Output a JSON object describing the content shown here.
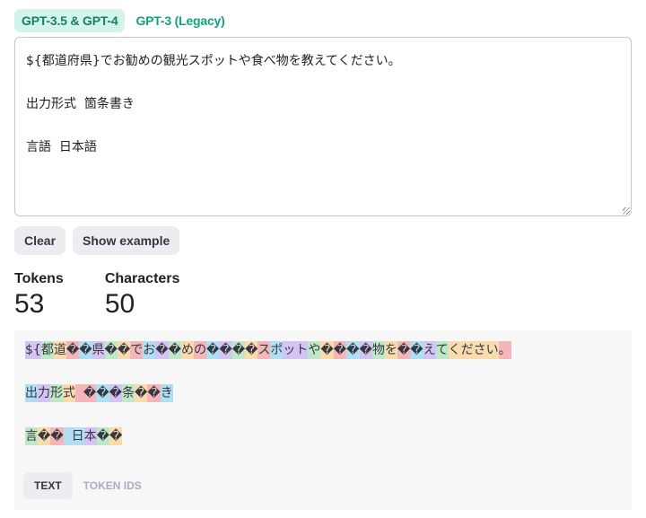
{
  "model_tabs": [
    {
      "label": "GPT-3.5 & GPT-4",
      "active": true
    },
    {
      "label": "GPT-3 (Legacy)",
      "active": false
    }
  ],
  "prompt": {
    "value": "${都道府県}でお勧めの観光スポットや食べ物を教えてください。\n\n出力形式  箇条書き\n\n言語  日本語"
  },
  "buttons": {
    "clear": "Clear",
    "show_example": "Show example"
  },
  "stats": {
    "tokens_label": "Tokens",
    "tokens_value": "53",
    "characters_label": "Characters",
    "characters_value": "50"
  },
  "token_palette": [
    "#d4c4f4",
    "#bfe8c8",
    "#f9dbae",
    "#f5b6ba",
    "#b0dff4"
  ],
  "tokenized_lines": [
    [
      {
        "t": "${",
        "c": 0
      },
      {
        "t": "都",
        "c": 1
      },
      {
        "t": "道",
        "c": 2
      },
      {
        "t": "�",
        "c": 3
      },
      {
        "t": "�",
        "c": 4
      },
      {
        "t": "県",
        "c": 0
      },
      {
        "t": "�",
        "c": 1
      },
      {
        "t": "�",
        "c": 2
      },
      {
        "t": "で",
        "c": 3
      },
      {
        "t": "お",
        "c": 4
      },
      {
        "t": "�",
        "c": 0
      },
      {
        "t": "�",
        "c": 1
      },
      {
        "t": "め",
        "c": 2
      },
      {
        "t": "の",
        "c": 3
      },
      {
        "t": "�",
        "c": 4
      },
      {
        "t": "�",
        "c": 0
      },
      {
        "t": "�",
        "c": 1
      },
      {
        "t": "�",
        "c": 2
      },
      {
        "t": "ス",
        "c": 3
      },
      {
        "t": "ポ",
        "c": 4
      },
      {
        "t": "ット",
        "c": 0
      },
      {
        "t": "や",
        "c": 1
      },
      {
        "t": "�",
        "c": 2
      },
      {
        "t": "�",
        "c": 3
      },
      {
        "t": "�",
        "c": 4
      },
      {
        "t": "�",
        "c": 0
      },
      {
        "t": "物",
        "c": 1
      },
      {
        "t": "を",
        "c": 2
      },
      {
        "t": "�",
        "c": 3
      },
      {
        "t": "�",
        "c": 4
      },
      {
        "t": "え",
        "c": 0
      },
      {
        "t": "て",
        "c": 1
      },
      {
        "t": "ください",
        "c": 2
      },
      {
        "t": "。",
        "c": 3
      }
    ],
    [
      {
        "t": "出",
        "c": 4
      },
      {
        "t": "力",
        "c": 0
      },
      {
        "t": "形",
        "c": 1
      },
      {
        "t": "式",
        "c": 2
      },
      {
        "t": "  �",
        "c": 3
      },
      {
        "t": "�",
        "c": 4
      },
      {
        "t": "�",
        "c": 0
      },
      {
        "t": "条",
        "c": 1
      },
      {
        "t": "�",
        "c": 2
      },
      {
        "t": "�",
        "c": 3
      },
      {
        "t": "き",
        "c": 4
      }
    ],
    [
      {
        "t": "言",
        "c": 1
      },
      {
        "t": "�",
        "c": 2
      },
      {
        "t": "�",
        "c": 3
      },
      {
        "t": "  日",
        "c": 4
      },
      {
        "t": "本",
        "c": 0
      },
      {
        "t": "�",
        "c": 1
      },
      {
        "t": "�",
        "c": 2
      }
    ]
  ],
  "view_tabs": [
    {
      "label": "TEXT",
      "active": true
    },
    {
      "label": "TOKEN IDS",
      "active": false
    }
  ]
}
